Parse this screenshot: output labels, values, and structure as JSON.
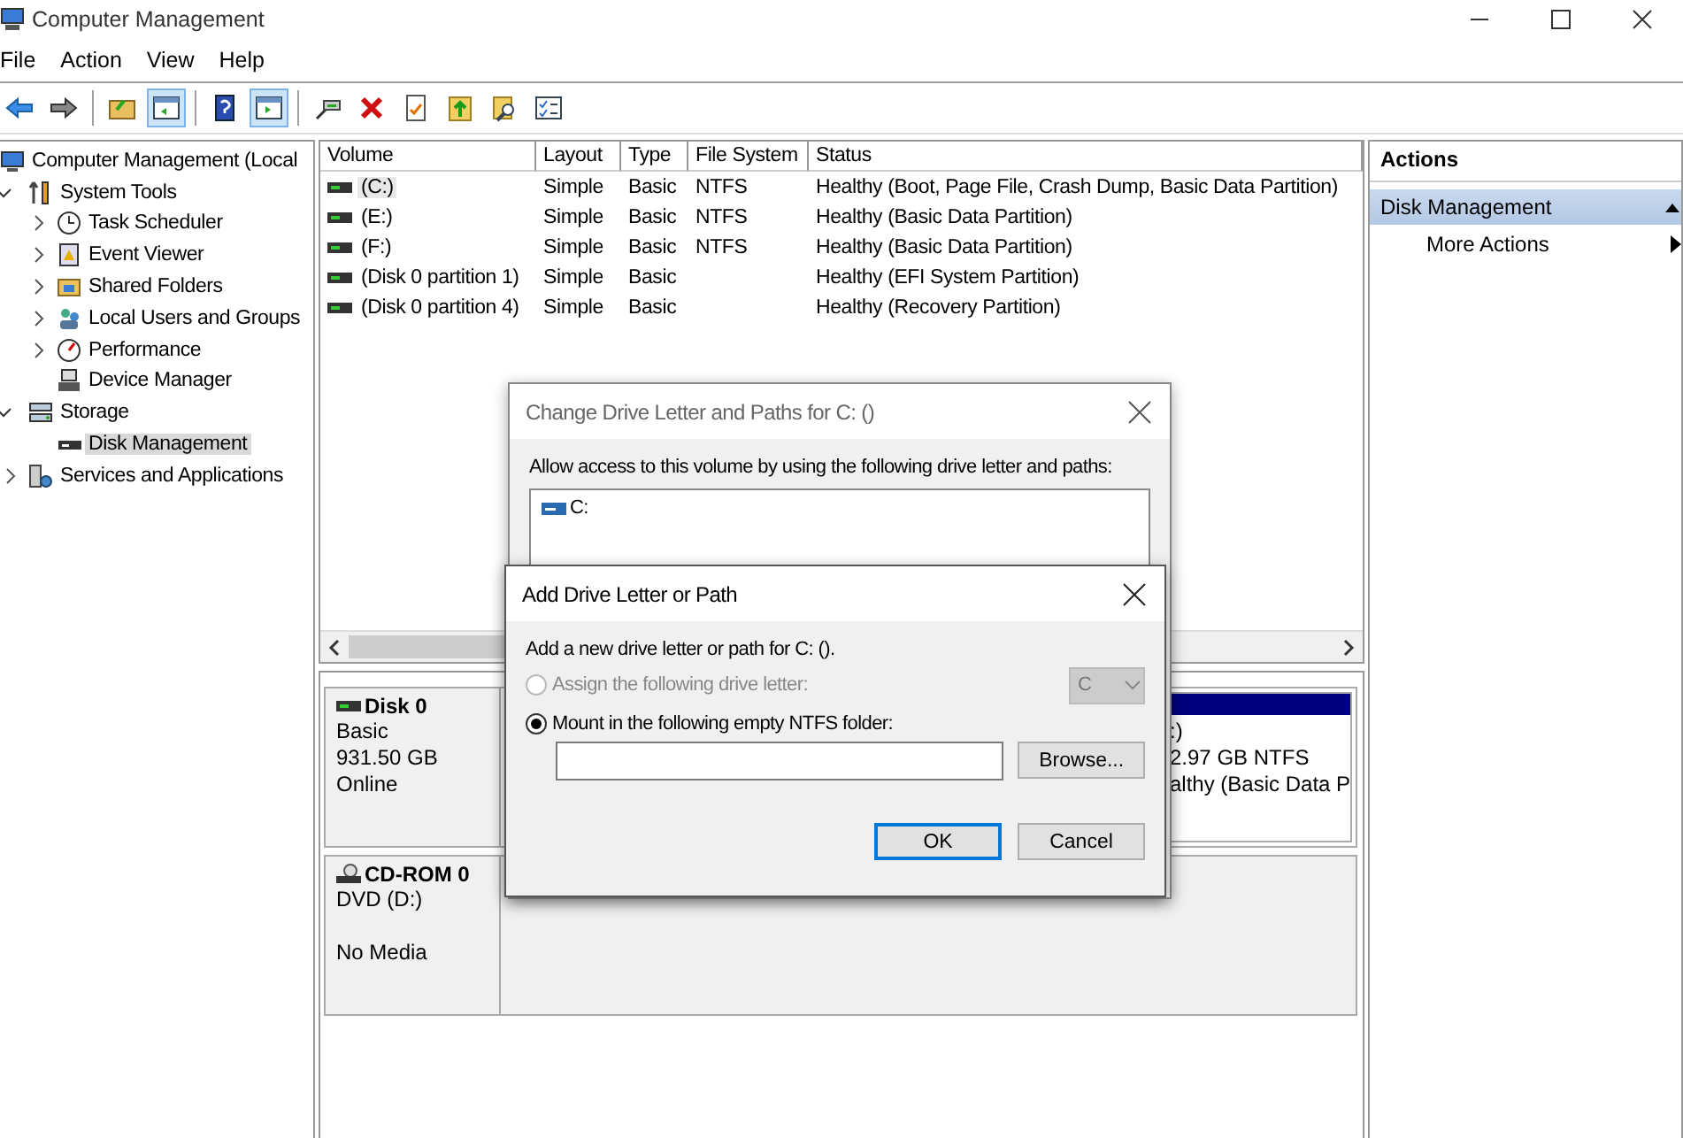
{
  "window": {
    "title": "Computer Management"
  },
  "menu": [
    "File",
    "Action",
    "View",
    "Help"
  ],
  "toolbar": [
    {
      "kind": "button",
      "pressed": false
    },
    {
      "kind": "button",
      "pressed": false
    },
    {
      "kind": "separator"
    },
    {
      "kind": "button",
      "pressed": false
    },
    {
      "kind": "button",
      "pressed": true
    },
    {
      "kind": "separator"
    },
    {
      "kind": "button",
      "pressed": false
    },
    {
      "kind": "button",
      "pressed": true
    },
    {
      "kind": "separator"
    },
    {
      "kind": "button",
      "pressed": false
    },
    {
      "kind": "button",
      "pressed": false
    },
    {
      "kind": "button",
      "pressed": false
    },
    {
      "kind": "button",
      "pressed": false
    },
    {
      "kind": "button",
      "pressed": false
    },
    {
      "kind": "button",
      "pressed": false
    }
  ],
  "tree": [
    {
      "label": "Computer Management (Local",
      "selected": false,
      "children": [
        {
          "label": "System Tools",
          "expanded": true,
          "selected": false,
          "children": [
            {
              "label": "Task Scheduler",
              "expanded": false,
              "selected": false
            },
            {
              "label": "Event Viewer",
              "expanded": false,
              "selected": false
            },
            {
              "label": "Shared Folders",
              "expanded": false,
              "selected": false
            },
            {
              "label": "Local Users and Groups",
              "expanded": false,
              "selected": false
            },
            {
              "label": "Performance",
              "expanded": false,
              "selected": false
            },
            {
              "label": "Device Manager",
              "selected": false
            }
          ]
        },
        {
          "label": "Storage",
          "expanded": true,
          "selected": false,
          "children": [
            {
              "label": "Disk Management",
              "selected": true
            }
          ]
        },
        {
          "label": "Services and Applications",
          "expanded": false,
          "selected": false
        }
      ]
    }
  ],
  "volumes": {
    "columns": [
      "Volume",
      "Layout",
      "Type",
      "File System",
      "Status"
    ],
    "rows": [
      {
        "selected": true,
        "cells": [
          "(C:)",
          "Simple",
          "Basic",
          "NTFS",
          "Healthy (Boot, Page File, Crash Dump, Basic Data Partition)"
        ]
      },
      {
        "selected": false,
        "cells": [
          "(E:)",
          "Simple",
          "Basic",
          "NTFS",
          "Healthy (Basic Data Partition)"
        ]
      },
      {
        "selected": false,
        "cells": [
          "(F:)",
          "Simple",
          "Basic",
          "NTFS",
          "Healthy (Basic Data Partition)"
        ]
      },
      {
        "selected": false,
        "cells": [
          "(Disk 0 partition 1)",
          "Simple",
          "Basic",
          "",
          "Healthy (EFI System Partition)"
        ]
      },
      {
        "selected": false,
        "cells": [
          "(Disk 0 partition 4)",
          "Simple",
          "Basic",
          "",
          "Healthy (Recovery Partition)"
        ]
      }
    ]
  },
  "disks": [
    {
      "kind": "disk",
      "name": "Disk 0",
      "lines": [
        "Basic",
        "931.50 GB"
      ],
      "status": "Online",
      "partitions": [
        {
          "label": ":)",
          "size": "2.97 GB NTFS",
          "status": "althy (Basic Data P"
        }
      ]
    },
    {
      "kind": "cdrom",
      "name": "CD-ROM 0",
      "lines": [
        "DVD (D:)"
      ],
      "status": "No Media"
    }
  ],
  "actions": {
    "title": "Actions",
    "group": "Disk Management",
    "items": [
      "More Actions"
    ]
  },
  "change_dialog": {
    "title": "Change Drive Letter and Paths for C: ()",
    "prompt": "Allow access to this volume by using the following drive letter and paths:",
    "paths": [
      "C:"
    ]
  },
  "add_dialog": {
    "title": "Add Drive Letter or Path",
    "prompt": "Add a new drive letter or path for C: ().",
    "options": [
      {
        "label": "Assign the following drive letter:",
        "selected": false,
        "disabled": true
      },
      {
        "label": "Mount in the following empty NTFS folder:",
        "selected": true,
        "disabled": false
      }
    ],
    "letter": {
      "value": "C",
      "disabled": true
    },
    "browse": "Browse...",
    "buttons": [
      {
        "label": "OK",
        "default": true
      },
      {
        "label": "Cancel",
        "default": false
      }
    ]
  }
}
